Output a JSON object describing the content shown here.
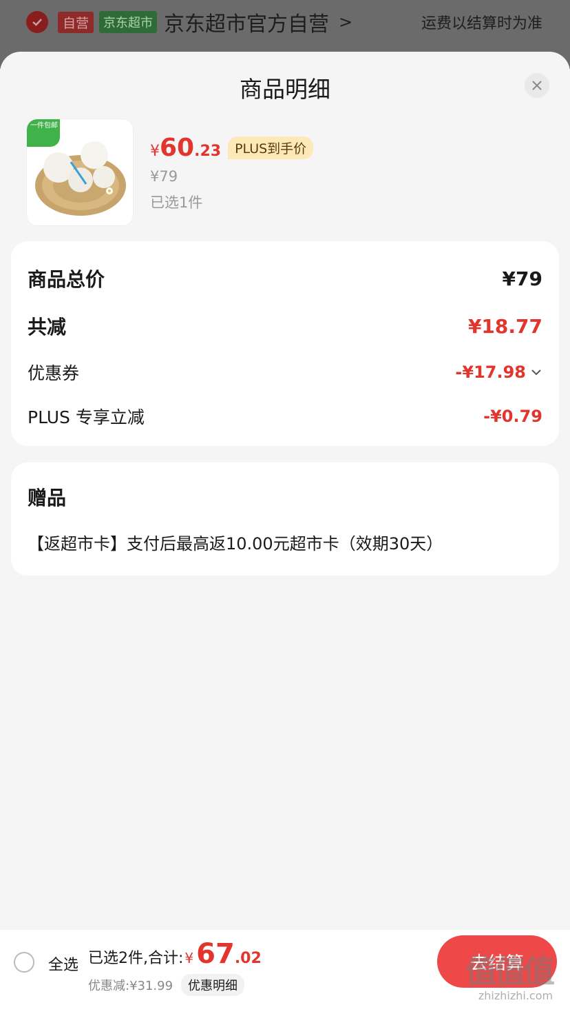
{
  "shop_header": {
    "tag_self": "自营",
    "tag_market": "京东超市",
    "shop_name": "京东超市官方自营",
    "chevron": ">",
    "shipping_note": "运费以结算时为准"
  },
  "sheet": {
    "title": "商品明细"
  },
  "product": {
    "badge": "一件包邮",
    "price_symbol": "¥",
    "price_int": "60",
    "price_dec": ".23",
    "plus_tag": "PLUS到手价",
    "original_price": "¥79",
    "selected_count": "已选1件"
  },
  "summary": {
    "total_label": "商品总价",
    "total_value": "¥79",
    "reduce_label": "共减",
    "reduce_value": "¥18.77",
    "coupon_label": "优惠券",
    "coupon_value": "-¥17.98",
    "plus_label": "PLUS 专享立减",
    "plus_value": "-¥0.79"
  },
  "gift": {
    "title": "赠品",
    "text": "【返超市卡】支付后最高返10.00元超市卡（效期30天）"
  },
  "bottom_bar": {
    "select_all": "全选",
    "sum_text": "已选2件,合计:",
    "sum_symbol": "¥",
    "sum_int": "67",
    "sum_dec": ".02",
    "discount_text": "优惠减:¥31.99",
    "discount_detail": "优惠明细",
    "checkout_label": "去结算"
  },
  "watermark": {
    "logo": "值值值",
    "url": "zhizhizhi.com"
  },
  "colors": {
    "accent_red": "#e2352d",
    "plus_gold": "#fde8b8",
    "checkout": "#ee4848"
  }
}
